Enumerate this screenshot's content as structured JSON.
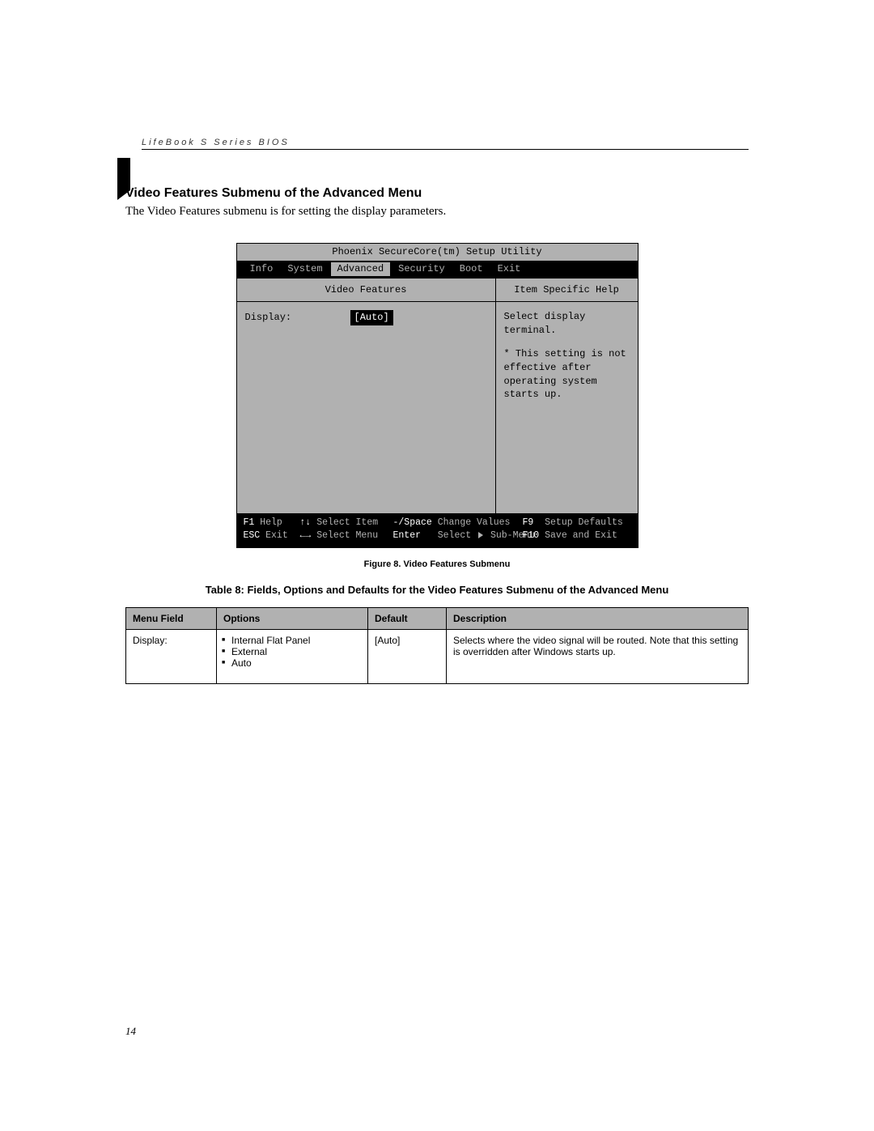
{
  "running_header": "LifeBook S Series BIOS",
  "section_heading": "Video Features Submenu of the Advanced Menu",
  "intro_text": "The Video Features submenu is for setting the display parameters.",
  "bios": {
    "title": "Phoenix SecureCore(tm) Setup Utility",
    "tabs": [
      "Info",
      "System",
      "Advanced",
      "Security",
      "Boot",
      "Exit"
    ],
    "active_tab_index": 2,
    "submenu_title": "Video Features",
    "help_panel_title": "Item Specific Help",
    "setting_label": "Display:",
    "setting_value": "[Auto]",
    "help_line1": "Select display terminal.",
    "help_note": "* This setting is not effective after operating system starts up.",
    "footer": {
      "f1": "F1",
      "f1_label": "Help",
      "updown": "↑↓",
      "updown_label": "Select Item",
      "minus_space": "-/Space",
      "change_values": "Change Values",
      "f9": "F9",
      "f9_label": "Setup Defaults",
      "esc": "ESC",
      "esc_label": "Exit",
      "leftright": "←→",
      "leftright_label": "Select Menu",
      "enter": "Enter",
      "select_sub": "Select",
      "submenu_word": "Sub-Menu",
      "f10": "F10",
      "f10_label": "Save and Exit"
    }
  },
  "figure_caption": "Figure 8.  Video Features Submenu",
  "table_caption": "Table 8: Fields, Options and Defaults for the Video Features Submenu of the Advanced Menu",
  "table": {
    "headers": [
      "Menu Field",
      "Options",
      "Default",
      "Description"
    ],
    "row": {
      "menu_field": "Display:",
      "options": [
        "Internal Flat Panel",
        "External",
        "Auto"
      ],
      "default": "[Auto]",
      "description": "Selects where the video signal will be routed. Note that this setting is overridden after Windows starts up."
    }
  },
  "page_number": "14"
}
